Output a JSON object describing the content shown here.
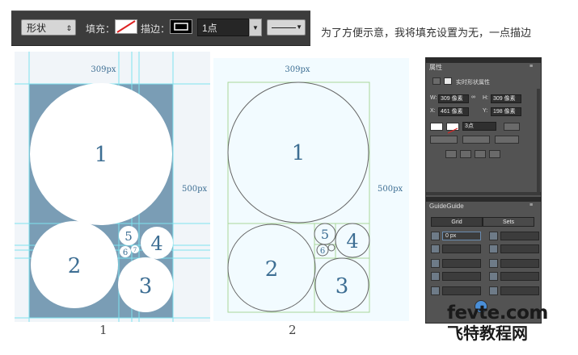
{
  "options_bar": {
    "shape_mode": "形状",
    "fill_label": "填充：",
    "stroke_label": "描边：",
    "stroke_size": "1点"
  },
  "caption": "为了方便示意，我将填充设置为无，一点描边",
  "figure1": {
    "width_label": "309px",
    "height_label": "500px",
    "circles": [
      "1",
      "2",
      "3",
      "4",
      "5",
      "6",
      "7"
    ],
    "figure_label": "1"
  },
  "figure2": {
    "width_label": "309px",
    "height_label": "500px",
    "circles": [
      "1",
      "2",
      "3",
      "4",
      "5",
      "6"
    ],
    "figure_label": "2"
  },
  "properties_panel": {
    "title": "属性",
    "section_title": "实时形状属性",
    "w_label": "W:",
    "w_value": "309 像素",
    "link_icon": "link-icon",
    "h_label": "H:",
    "h_value": "309 像素",
    "x_label": "X:",
    "x_value": "461 像素",
    "y_label": "Y:",
    "y_value": "198 像素",
    "stroke_size": "3点"
  },
  "guideguide_panel": {
    "title": "GuideGuide",
    "tab_grid": "Grid",
    "tab_sets": "Sets",
    "margin_value": "0 px"
  },
  "watermark": {
    "line1": "fevte.com",
    "line2": "飞特教程网"
  },
  "colors": {
    "fig1_background": "#7a9db5",
    "guide_cyan": "#7fe3ef",
    "guide_green": "#a9d79a",
    "text_blue": "#3d6e93",
    "ps_panel": "#535353"
  }
}
